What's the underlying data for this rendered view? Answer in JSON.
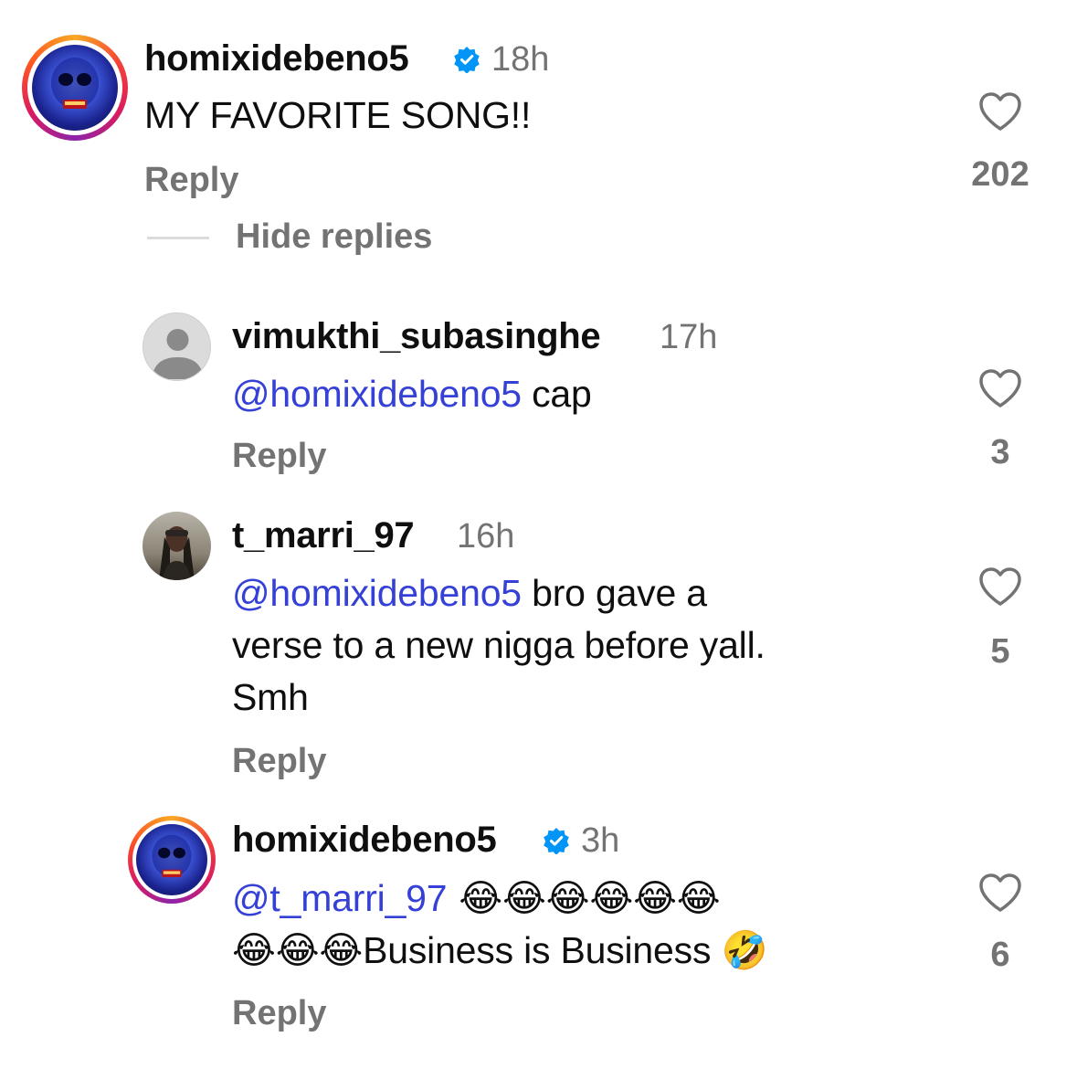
{
  "comments": [
    {
      "username": "homixidebeno5",
      "verified": true,
      "time": "18h",
      "text": "MY FAVORITE SONG!!",
      "reply_label": "Reply",
      "likes": "202",
      "avatar_icon": "skull-avatar-with-story-ring"
    },
    {
      "username": "vimukthi_subasinghe",
      "verified": false,
      "time": "17h",
      "mention": "@homixidebeno5",
      "text": " cap",
      "reply_label": "Reply",
      "likes": "3",
      "avatar_icon": "default-profile-avatar"
    },
    {
      "username": "t_marri_97",
      "verified": false,
      "time": "16h",
      "mention": "@homixidebeno5",
      "text_line1": " bro gave a",
      "text_line2": "verse to a new nigga before yall.",
      "text_line3": "Smh",
      "reply_label": "Reply",
      "likes": "5",
      "avatar_icon": "user-photo-avatar"
    },
    {
      "username": "homixidebeno5",
      "verified": true,
      "time": "3h",
      "mention": "@t_marri_97",
      "emoji_line1": " 😂😂😂😂😂😂",
      "emoji_line2": "😂😂😂",
      "text": "Business is Business ",
      "trailing_emoji": "🤣",
      "reply_label": "Reply",
      "likes": "6",
      "avatar_icon": "skull-avatar-with-story-ring"
    }
  ],
  "hide_replies_label": "Hide replies",
  "colors": {
    "mention": "#3541d6",
    "secondary_text": "#737373",
    "verified_badge": "#0095f6"
  }
}
